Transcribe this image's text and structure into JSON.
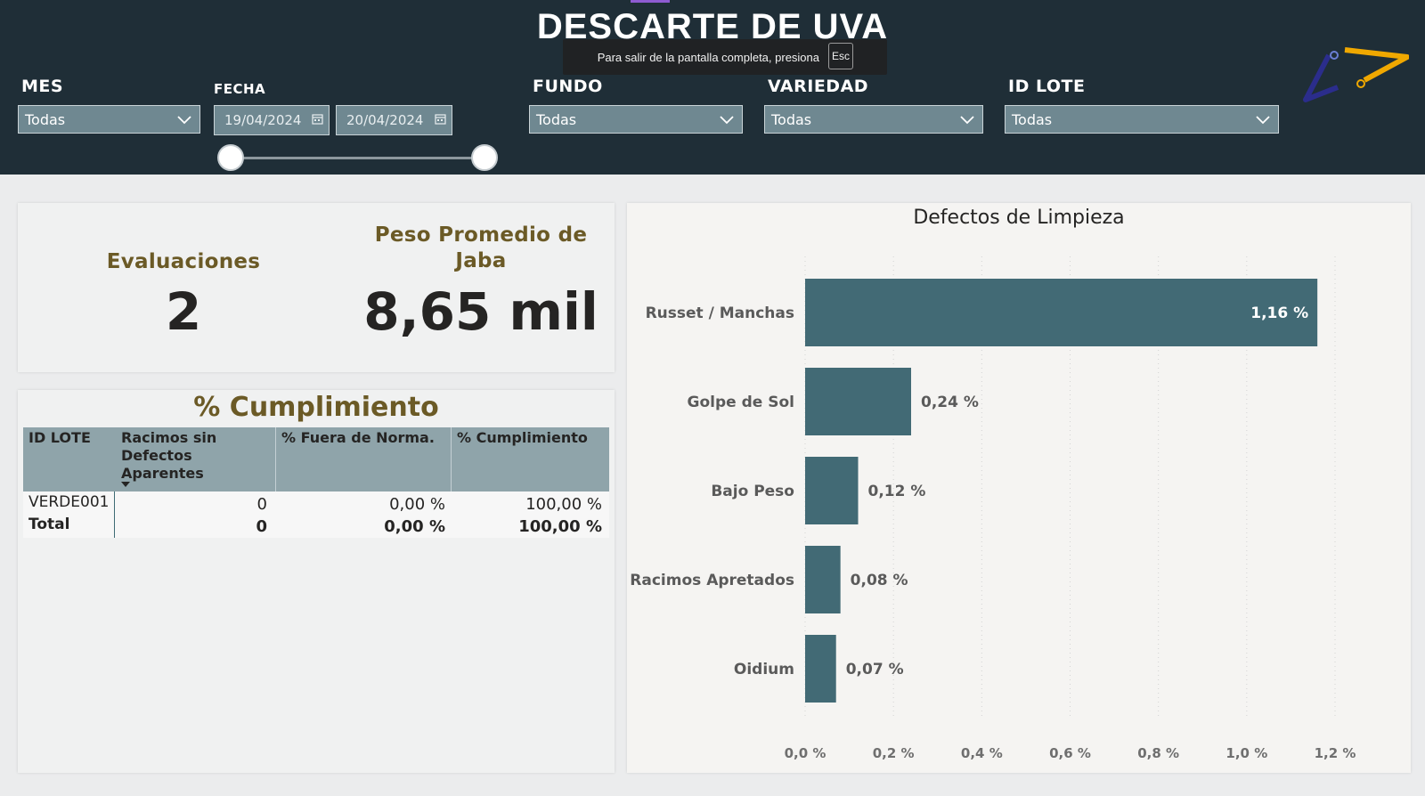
{
  "header": {
    "title": "DESCARTE DE UVA",
    "fullscreen_toast": {
      "text": "Para salir de la pantalla completa, presiona",
      "key": "Esc"
    }
  },
  "filters": {
    "mes": {
      "label": "MES",
      "value": "Todas"
    },
    "fecha": {
      "label": "FECHA",
      "start": "19/04/2024",
      "end": "20/04/2024",
      "range": [
        0,
        1
      ]
    },
    "fundo": {
      "label": "FUNDO",
      "value": "Todas"
    },
    "variedad": {
      "label": "VARIEDAD",
      "value": "Todas"
    },
    "id_lote": {
      "label": "ID LOTE",
      "value": "Todas"
    }
  },
  "kpis": {
    "evaluaciones": {
      "label": "Evaluaciones",
      "value": "2"
    },
    "peso_promedio": {
      "label_line1": "Peso Promedio de",
      "label_line2": "Jaba",
      "value": "8,65 mil"
    }
  },
  "cumplimiento_table": {
    "title": "% Cumplimiento",
    "headers": {
      "id_lote": "ID LOTE",
      "racimos_line1": "Racimos sin",
      "racimos_line2": "Defectos",
      "racimos_line3": "Aparentes",
      "fuera_norma": "% Fuera de Norma.",
      "cumplimiento": "% Cumplimiento"
    },
    "rows": [
      {
        "id_lote": "VERDE001",
        "racimos": "0",
        "fuera_norma": "0,00 %",
        "cumplimiento": "100,00 %"
      }
    ],
    "total": {
      "label": "Total",
      "racimos": "0",
      "fuera_norma": "0,00 %",
      "cumplimiento": "100,00 %"
    }
  },
  "chart_data": {
    "type": "bar",
    "orientation": "horizontal",
    "title": "Defectos de Limpieza",
    "categories": [
      "Russet / Manchas",
      "Golpe de Sol",
      "Bajo Peso",
      "Racimos Apretados",
      "Oidium"
    ],
    "values": [
      1.16,
      0.24,
      0.12,
      0.08,
      0.07
    ],
    "data_labels": [
      "1,16 %",
      "0,24 %",
      "0,12 %",
      "0,08 %",
      "0,07 %"
    ],
    "xlim": [
      0,
      1.2
    ],
    "x_ticks": [
      0,
      0.2,
      0.4,
      0.6,
      0.8,
      1.0,
      1.2
    ],
    "x_tick_labels": [
      "0,0 %",
      "0,2 %",
      "0,4 %",
      "0,6 %",
      "0,8 %",
      "1,0 %",
      "1,2 %"
    ],
    "grid": "vertical dotted",
    "colors": {
      "bar": "#426a75",
      "label_inside": "#ffffff",
      "label_outside": "#5a5a5a"
    }
  },
  "colors": {
    "header_bg": "#1f2e37",
    "accent_gold": "#6b5a26",
    "slicer_bg": "#6f8891",
    "table_header_bg": "#8fa4aa"
  }
}
